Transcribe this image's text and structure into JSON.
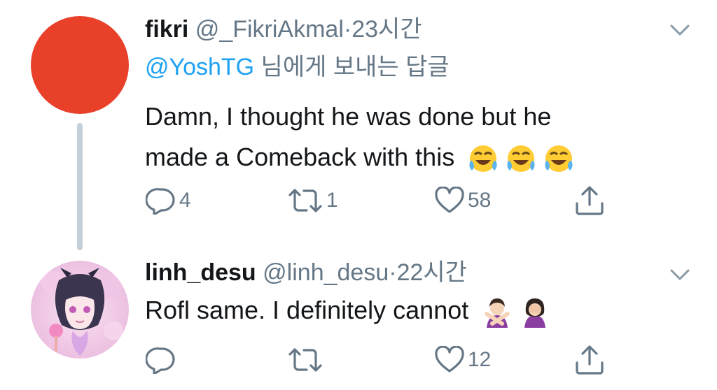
{
  "tweets": [
    {
      "name": "fikri",
      "handle": "@_FikriAkmal",
      "separator": "·",
      "time": "23시간",
      "reply_to_mention": "@YoshTG",
      "reply_to_suffix": " 님에게 보내는 답글",
      "text_line1": "Damn, I thought he was done but he",
      "text_line2": "made a Comeback with this",
      "emoji": [
        "face-with-tears-of-joy",
        "face-with-tears-of-joy",
        "face-with-tears-of-joy"
      ],
      "reply_count": "4",
      "retweet_count": "1",
      "like_count": "58",
      "avatar_color": "#e9402a"
    },
    {
      "name": "linh_desu",
      "handle": "@linh_desu",
      "separator": "·",
      "time": "22시간",
      "text_line1": "Rofl same. I definitely cannot",
      "emoji": [
        "person-gesturing-no",
        "person-facepalming"
      ],
      "reply_count": "",
      "retweet_count": "",
      "like_count": "12"
    }
  ],
  "colors": {
    "link": "#1da1f2",
    "secondary_text": "#657786",
    "thread_line": "#c5cfd8"
  }
}
